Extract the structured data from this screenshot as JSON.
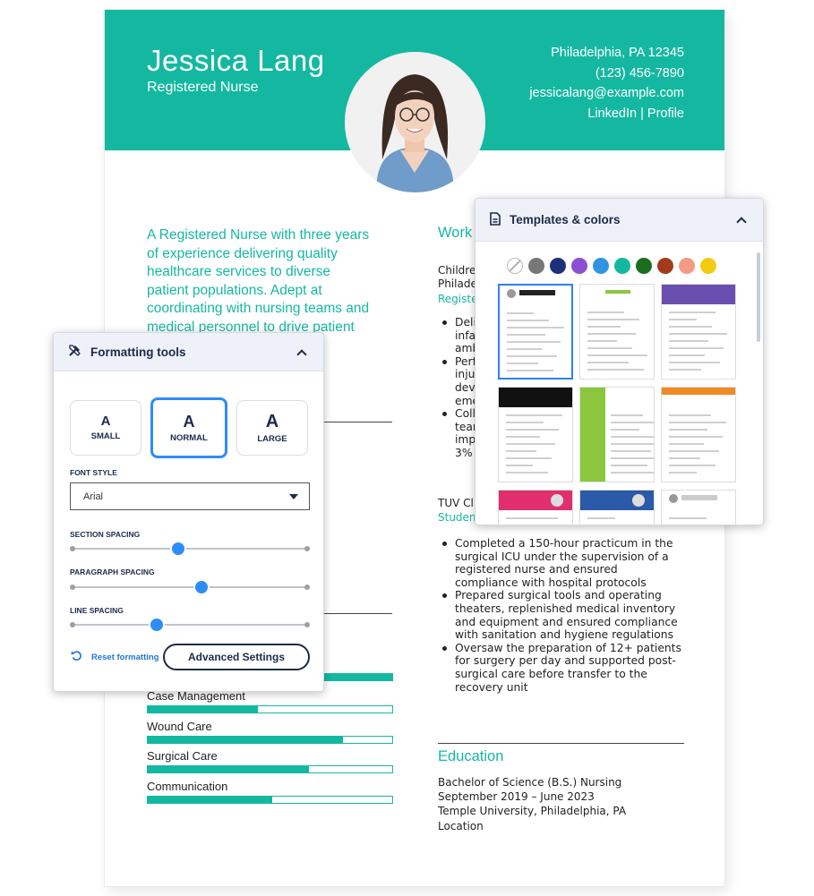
{
  "resume": {
    "name": "Jessica Lang",
    "title": "Registered Nurse",
    "contact": {
      "location": "Philadelphia, PA 12345",
      "phone": "(123) 456-7890",
      "email": "jessicalang@example.com",
      "links": "LinkedIn | Profile"
    },
    "summary": "A Registered Nurse with three years of experience delivering quality healthcare services to diverse patient populations. Adept at coordinating with nursing teams and medical personnel to drive patient outcomes in high-pressure environments.",
    "work_title": "Work",
    "job1": {
      "company": "Childre",
      "location": "Philade",
      "role": "Registe",
      "bullets": [
        "Deli",
        "infa",
        "amb",
        "Perf",
        "injur",
        "devi",
        "eme",
        "Coll",
        "tear",
        "imp",
        "3%"
      ]
    },
    "job2": {
      "company": "TUV Cli",
      "role": "Studen",
      "bullets": [
        "Completed a 150-hour practicum in the surgical ICU under the supervision of a registered nurse and ensured compliance with hospital protocols",
        "Prepared surgical tools and operating theaters, replenished medical inventory and equipment and ensured compliance with sanitation and hygiene regulations",
        "Oversaw the preparation of 12+ patients for surgery per day and supported post-surgical care before transfer to the recovery unit"
      ]
    },
    "skills": [
      {
        "name": "Case Management",
        "level": 0.45
      },
      {
        "name": "Wound Care",
        "level": 0.8
      },
      {
        "name": "Surgical Care",
        "level": 0.66
      },
      {
        "name": "Communication",
        "level": 0.51
      }
    ],
    "education": {
      "title": "Education",
      "degree": "Bachelor of Science (B.S.) Nursing",
      "dates": "September 2019 – June 2023",
      "school": "Temple University, Philadelphia, PA",
      "location": "Location"
    }
  },
  "templates_panel": {
    "title": "Templates & colors",
    "icon": "document-icon",
    "colors": [
      "none",
      "#777777",
      "#1e2f7a",
      "#8a4fd1",
      "#2f95e0",
      "#14b8a0",
      "#1b6e1e",
      "#a33a1a",
      "#f39a85",
      "#f2cc12"
    ],
    "thumb_header_name": "Jessica Lang",
    "thumbs": [
      {
        "accent": "#222222",
        "style": "photo-top",
        "selected": true
      },
      {
        "accent": "#8cc63f",
        "style": "centered"
      },
      {
        "accent": "#6a4fb0",
        "style": "band"
      },
      {
        "accent": "#111111",
        "style": "band"
      },
      {
        "accent": "#8cc63f",
        "style": "sidebar"
      },
      {
        "accent": "#f08a24",
        "style": "topbar"
      },
      {
        "accent": "#e02f6c",
        "style": "band-photo"
      },
      {
        "accent": "#2a5aa8",
        "style": "band-photo"
      },
      {
        "accent": "#ffffff",
        "style": "photo-plain"
      }
    ]
  },
  "formatting_panel": {
    "title": "Formatting tools",
    "sizes": [
      {
        "glyph": "A",
        "label": "SMALL"
      },
      {
        "glyph": "A",
        "label": "NORMAL"
      },
      {
        "glyph": "A",
        "label": "LARGE"
      }
    ],
    "selected_size": "NORMAL",
    "font_style_label": "FONT STYLE",
    "font_value": "Arial",
    "section_spacing_label": "SECTION SPACING",
    "section_spacing": 0.45,
    "paragraph_spacing_label": "PARAGRAPH SPACING",
    "paragraph_spacing": 0.55,
    "line_spacing_label": "LINE SPACING",
    "line_spacing": 0.36,
    "reset_label": "Reset formatting",
    "advanced_label": "Advanced Settings"
  }
}
